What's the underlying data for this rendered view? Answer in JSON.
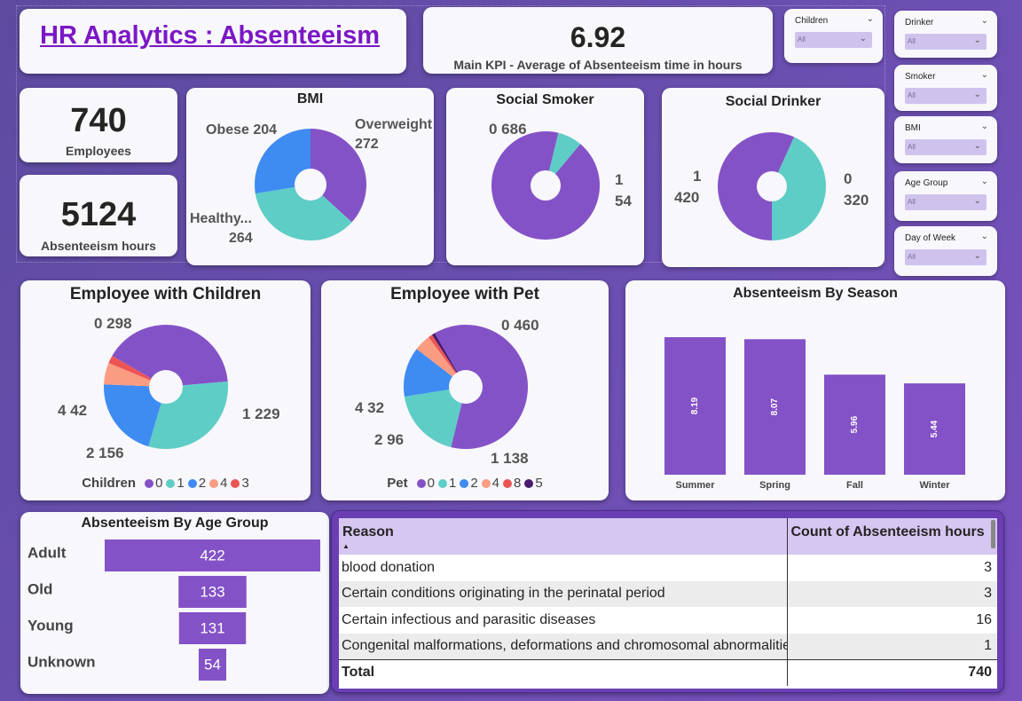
{
  "header": {
    "title": "HR Analytics : Absenteeism",
    "kpi_value": "6.92",
    "kpi_label": "Main KPI - Average of Absenteeism time in hours"
  },
  "cards": {
    "employees_value": "740",
    "employees_label": "Employees",
    "hours_value": "5124",
    "hours_label": "Absenteeism hours"
  },
  "slicers": [
    {
      "name": "Children",
      "value": "All"
    },
    {
      "name": "Drinker",
      "value": "All"
    },
    {
      "name": "Smoker",
      "value": "All"
    },
    {
      "name": "BMI",
      "value": "All"
    },
    {
      "name": "Age Group",
      "value": "All"
    },
    {
      "name": "Day of Week",
      "value": "All"
    }
  ],
  "colors": {
    "purple": "#8452c7",
    "teal": "#5ecdc6",
    "blue": "#3e8bf1",
    "salmon": "#f99c82",
    "red": "#ec5454",
    "darkpurple": "#4a1a6e",
    "bar": "#8452c7"
  },
  "chart_data": [
    {
      "type": "pie",
      "title": "BMI",
      "labels": [
        "Overweight",
        "Healthy...",
        "Obese"
      ],
      "values": [
        272,
        264,
        204
      ],
      "label_text": [
        "Overweight",
        "272",
        "Healthy...",
        "264",
        "Obese 204"
      ]
    },
    {
      "type": "pie",
      "title": "Social Smoker",
      "labels": [
        "0",
        "1"
      ],
      "values": [
        686,
        54
      ],
      "label_text": [
        "0 686",
        "1",
        "54"
      ]
    },
    {
      "type": "pie",
      "title": "Social Drinker",
      "labels": [
        "1",
        "0"
      ],
      "values": [
        420,
        320
      ],
      "label_text": [
        "1",
        "420",
        "0",
        "320"
      ]
    },
    {
      "type": "pie",
      "title": "Employee with Children",
      "legend_title": "Children",
      "labels": [
        "0",
        "1",
        "2",
        "4",
        "3"
      ],
      "values": [
        298,
        229,
        156,
        42,
        15
      ],
      "label_text": [
        "0 298",
        "1 229",
        "2 156",
        "4 42"
      ]
    },
    {
      "type": "pie",
      "title": "Employee with Pet",
      "legend_title": "Pet",
      "labels": [
        "0",
        "1",
        "2",
        "4",
        "8",
        "5"
      ],
      "values": [
        460,
        138,
        96,
        32,
        8,
        6
      ],
      "label_text": [
        "0 460",
        "1 138",
        "2 96",
        "4 32"
      ]
    },
    {
      "type": "bar",
      "title": "Absenteeism By Season",
      "categories": [
        "Summer",
        "Spring",
        "Fall",
        "Winter"
      ],
      "values": [
        8.19,
        8.07,
        5.96,
        5.44
      ],
      "value_text": [
        "8.19",
        "8.07",
        "5.96",
        "5.44"
      ]
    },
    {
      "type": "bar",
      "title": "Absenteeism By Age Group",
      "categories": [
        "Adult",
        "Old",
        "Young",
        "Unknown"
      ],
      "values": [
        422,
        133,
        131,
        54
      ],
      "value_text": [
        "422",
        "133",
        "131",
        "54"
      ]
    }
  ],
  "table": {
    "headers": [
      "Reason",
      "Count of Absenteeism hours"
    ],
    "rows": [
      [
        "blood donation",
        "3"
      ],
      [
        "Certain conditions originating in the perinatal period",
        "3"
      ],
      [
        "Certain infectious and parasitic diseases",
        "16"
      ],
      [
        "Congenital malformations, deformations and chromosomal abnormalities",
        "1"
      ]
    ],
    "total_label": "Total",
    "total_value": "740"
  }
}
